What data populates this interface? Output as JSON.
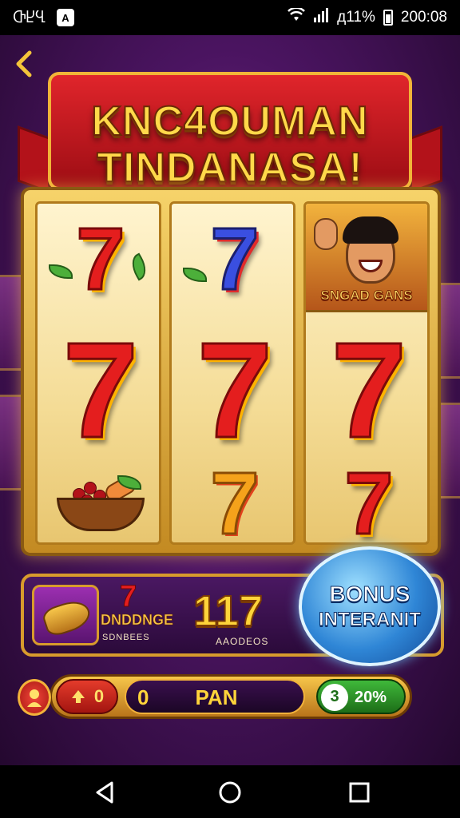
{
  "status_bar": {
    "left_text": "ႧႾႡ",
    "notif_icon": "A",
    "signal_text": "д11%",
    "time": "200:08"
  },
  "game": {
    "back_icon": "chevron-left-icon",
    "title": {
      "line1": "KNC4OUMAN",
      "line2": "TINDANASA!"
    },
    "reels": [
      {
        "top": "7",
        "middle": "7",
        "bottom": "basket"
      },
      {
        "top": "7",
        "middle": "7",
        "bottom": "7"
      },
      {
        "top": "character",
        "middle": "7",
        "bottom": "7"
      }
    ],
    "character_label": "SNGAD GANS",
    "info_panel": {
      "mini_symbol": "7",
      "label_main": "DNDDNGE",
      "label_sub": "SDNBEES",
      "count_value": "117",
      "count_label": "AAODEOS"
    },
    "bonus": {
      "line1": "BONUS",
      "line2": "INTERANIT"
    },
    "controls": {
      "bet_value": "0",
      "spin_value": "0",
      "spin_label": "PAN",
      "percent_icon_text": "3",
      "percent_value": "20%"
    }
  },
  "colors": {
    "background": "#4a1460",
    "banner_red": "#c4161d",
    "gold": "#f2b23a",
    "bonus_blue": "#2f86d6"
  }
}
